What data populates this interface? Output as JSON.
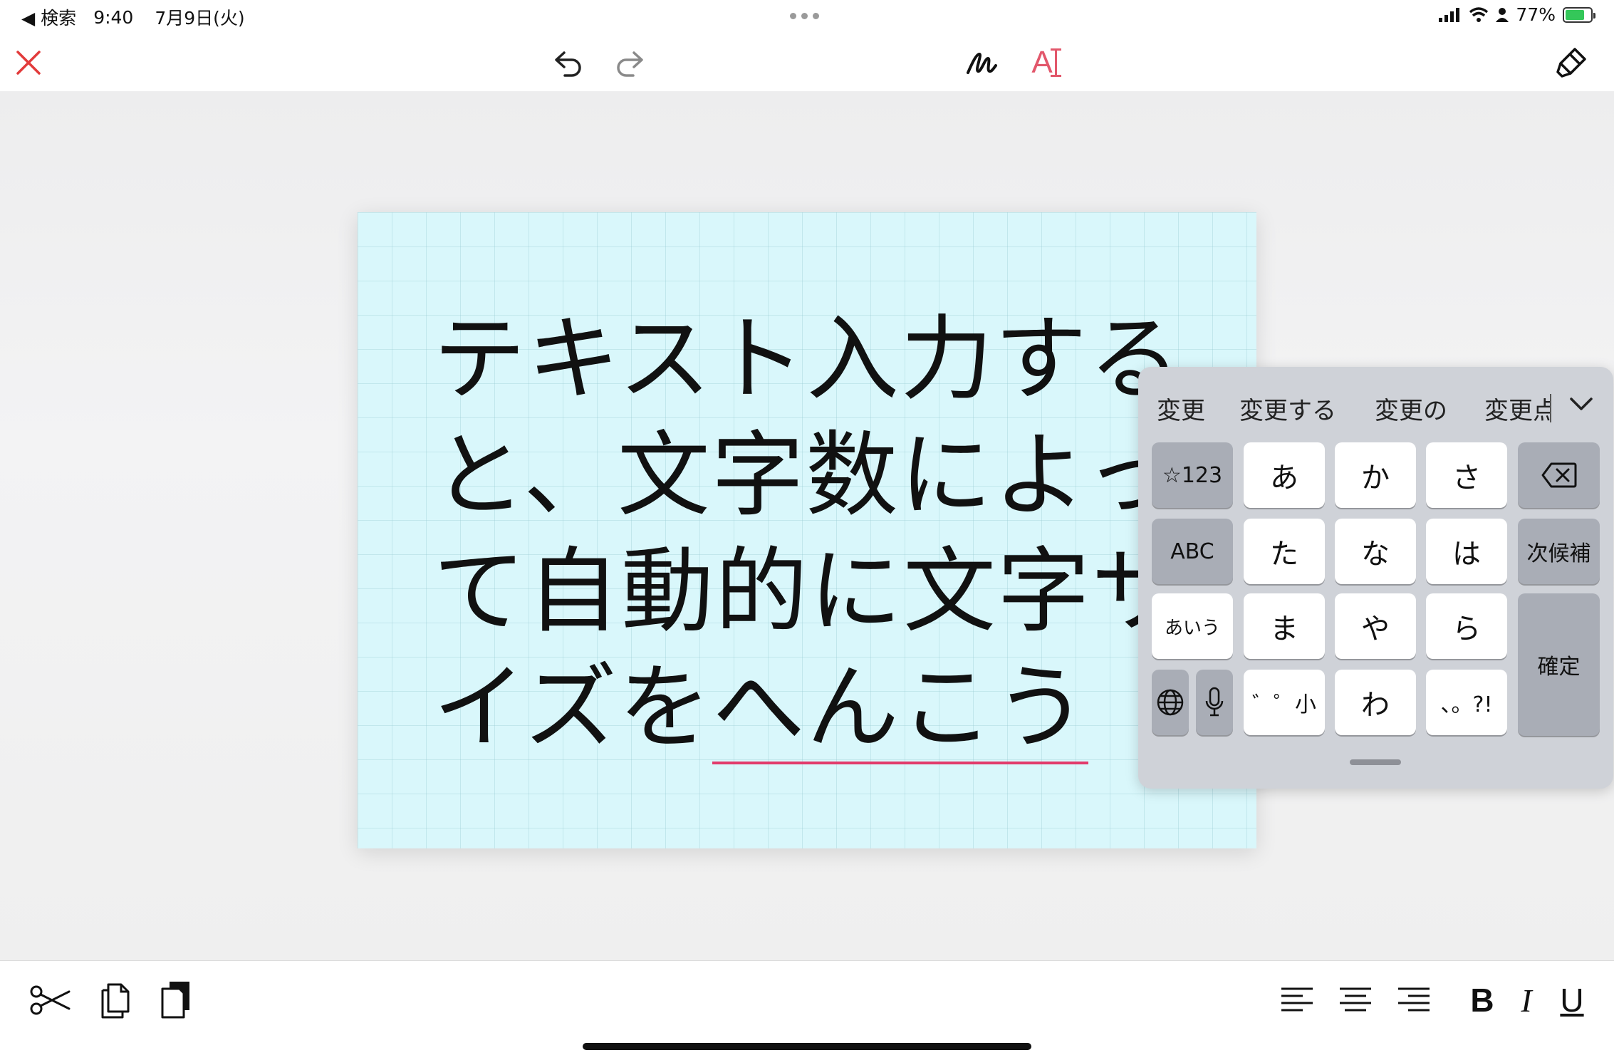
{
  "status_bar": {
    "back_label": "◀ 検索",
    "time": "9:40",
    "date": "7月9日(火)",
    "battery_percent": "77%",
    "battery_level": 0.77,
    "battery_color": "#34c759"
  },
  "toolbar": {
    "close_icon": "close-x-icon",
    "undo_icon": "undo-icon",
    "redo_icon": "redo-icon",
    "pen_icon": "pen-scribble-icon",
    "text_tool_label": "A",
    "text_tool_color": "#e2576b",
    "eraser_icon": "eraser-icon",
    "accent_color": "#e23b3b"
  },
  "note": {
    "lines": [
      "テキスト入力する",
      "と、文字数によっ",
      "て自動的に文字サ"
    ],
    "last_line_fixed": "イズを",
    "last_line_composing": "へんこう",
    "underline_color": "#e23a6b",
    "background_color": "#d9f7fb"
  },
  "keyboard": {
    "candidates": [
      "変更",
      "変更する",
      "変更の",
      "変更点"
    ],
    "keys": {
      "numbers": "☆123",
      "a": "あ",
      "ka": "か",
      "sa": "さ",
      "abc": "ABC",
      "ta": "た",
      "na": "な",
      "ha": "は",
      "next_candidate": "次候補",
      "aiu": "あいう",
      "ma": "ま",
      "ya": "や",
      "ra": "ら",
      "confirm": "確定",
      "dakuten": "゛゜小",
      "wa": "わ",
      "punct": "、。?!"
    }
  },
  "bottom_bar": {
    "bold_label": "B",
    "italic_label": "I",
    "underline_label": "U"
  }
}
